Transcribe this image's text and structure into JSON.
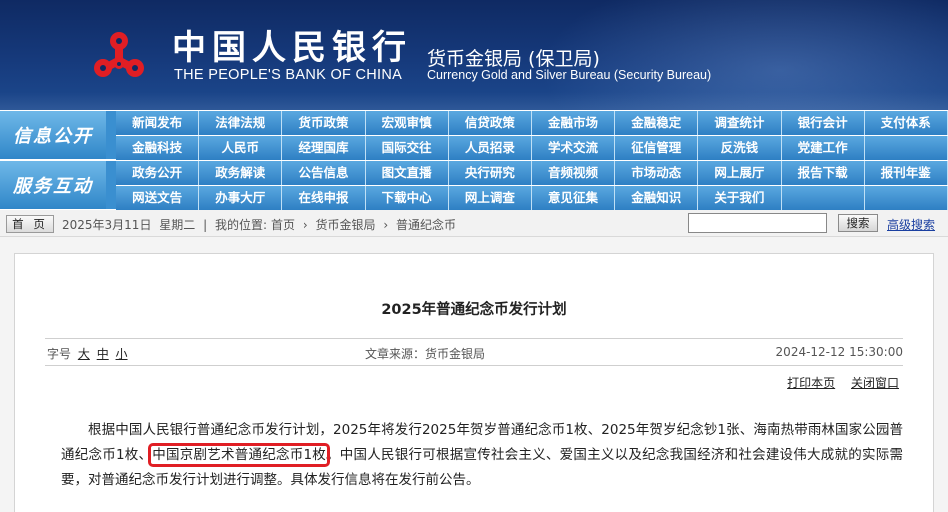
{
  "header": {
    "cn_name": "中国人民银行",
    "en_name": "THE PEOPLE'S BANK OF CHINA",
    "bureau_cn": "货币金银局 (保卫局)",
    "bureau_en": "Currency  Gold and Silver Bureau (Security Bureau)",
    "logo_icon": "pboc-logo-icon",
    "brand_colors": {
      "banner": "#163a7c",
      "logo": "#e01e24",
      "nav": "#2e7fc3"
    }
  },
  "nav": {
    "info": {
      "label": "信息公开",
      "row1": [
        "新闻发布",
        "法律法规",
        "货币政策",
        "宏观审慎",
        "信贷政策",
        "金融市场",
        "金融稳定",
        "调查统计",
        "银行会计",
        "支付体系"
      ],
      "row2": [
        "金融科技",
        "人民币",
        "经理国库",
        "国际交往",
        "人员招录",
        "学术交流",
        "征信管理",
        "反洗钱",
        "党建工作",
        ""
      ]
    },
    "service": {
      "label": "服务互动",
      "row1": [
        "政务公开",
        "政务解读",
        "公告信息",
        "图文直播",
        "央行研究",
        "音频视频",
        "市场动态",
        "网上展厅",
        "报告下载",
        "报刊年鉴"
      ],
      "row2": [
        "网送文告",
        "办事大厅",
        "在线申报",
        "下载中心",
        "网上调查",
        "意见征集",
        "金融知识",
        "关于我们",
        "",
        ""
      ]
    }
  },
  "breadcrumb": {
    "home_label": "首 页",
    "date": "2025年3月11日",
    "weekday": "星期二",
    "location_prefix": "我的位置:",
    "items": [
      "首页",
      "货币金银局",
      "普通纪念币"
    ],
    "separator": "›"
  },
  "search": {
    "placeholder": "",
    "value": "",
    "button_label": "搜索",
    "advanced_label": "高级搜索"
  },
  "article": {
    "title": "2025年普通纪念币发行计划",
    "fontsize_label": "字号",
    "fontsize_options": [
      "大",
      "中",
      "小"
    ],
    "source": "文章来源：货币金银局",
    "date": "2024-12-12 15:30:00",
    "print_label": "打印本页",
    "close_label": "关闭窗口",
    "body_before": "根据中国人民银行普通纪念币发行计划，2025年将发行2025年贺岁普通纪念币1枚、2025年贺岁纪念钞1张、海南热带雨林国家公园普通纪念币1枚、",
    "body_highlight": "中国京剧艺术普通纪念币1枚",
    "body_after": "。中国人民银行可根据宣传社会主义、爱国主义以及纪念我国经济和社会建设伟大成就的实际需要，对普通纪念币发行计划进行调整。具体发行信息将在发行前公告。",
    "highlight_color": "#e01e24"
  }
}
